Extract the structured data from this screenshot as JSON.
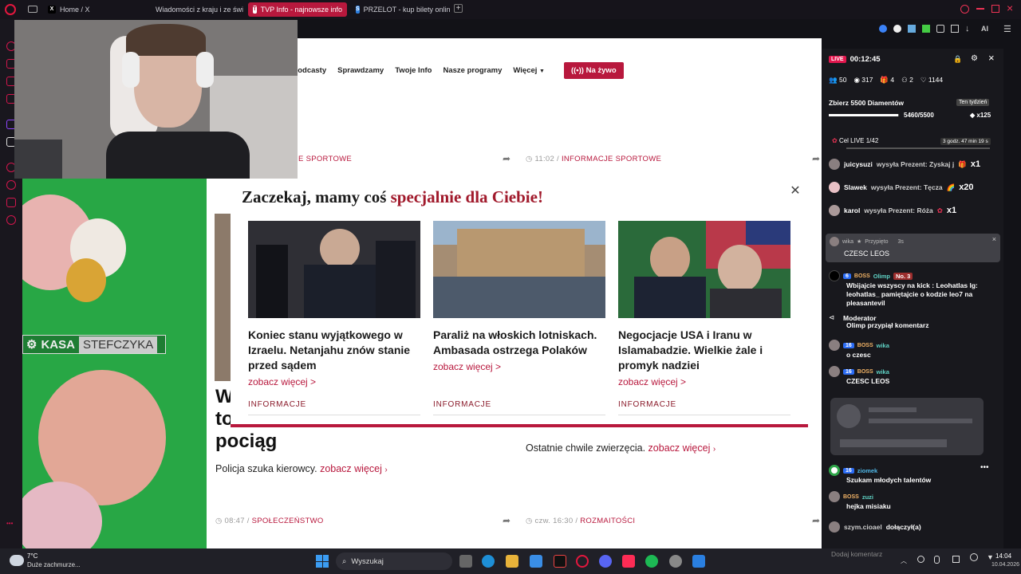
{
  "tabs": [
    {
      "label": "",
      "favicon": "app"
    },
    {
      "label": "",
      "favicon": "panel"
    },
    {
      "label": "Home / X",
      "favicon": "x"
    },
    {
      "label": "Wiadomości z kraju i ze świ",
      "favicon": "globe"
    },
    {
      "label": "TVP Info - najnowsze info",
      "favicon": "tvp",
      "active": true
    },
    {
      "label": "PRZELOT - kup bilety onlin",
      "favicon": "przelot"
    }
  ],
  "nav": {
    "items": [
      "Podcasty",
      "Sprawdzamy",
      "Twoje Info",
      "Nasze programy",
      "Więcej"
    ],
    "live_label": "Na żywo",
    "partial_left": "rt"
  },
  "articles_top": {
    "left_category": "E SPORTOWE",
    "right_time": "11:02",
    "right_category": "INFORMACJE SPORTOWE"
  },
  "ad": {
    "brand_left": "KASA",
    "brand_right": "STEFCZYKA"
  },
  "main_article": {
    "headline_lines": [
      "W",
      "to",
      "pociąg"
    ],
    "lead": "Policja szuka kierowcy.",
    "more": "zobacz więcej",
    "time": "08:47",
    "category": "SPOŁECZEŃSTWO"
  },
  "side_article": {
    "lead": "Ostatnie chwile zwierzęcia.",
    "more": "zobacz więcej",
    "time": "czw. 16:30",
    "category": "ROZMAITOŚCI"
  },
  "modal": {
    "title_plain": "Zaczekaj, mamy coś ",
    "title_accent": "specjalnie dla Ciebie!",
    "cards": [
      {
        "title": "Koniec stanu wyjątkowego w Izraelu. Netanjahu znów stanie przed sądem",
        "more": "zobacz więcej >",
        "category": "INFORMACJE"
      },
      {
        "title": "Paraliż na włoskich lotniskach. Ambasada ostrzega Polaków",
        "more": "zobacz więcej >",
        "category": "INFORMACJE"
      },
      {
        "title": "Negocjacje USA i Iranu w Islamabadzie. Wielkie żale i promyk nadziei",
        "more": "zobacz więcej >",
        "category": "INFORMACJE"
      }
    ]
  },
  "panel": {
    "live_badge": "LIVE",
    "timer": "00:12:45",
    "stats": [
      "50",
      "317",
      "4",
      "2",
      "1144"
    ],
    "goal_title": "Zbierz 5500 Diamentów",
    "goal_period": "Ten tydzień",
    "goal_progress_text": "5460/5500",
    "goal_progress": 0.993,
    "goal_multiplier": "x125",
    "live_goal": "Cel LIVE 1/42",
    "live_goal_time": "3 godz. 47 min 19 s",
    "gifts": [
      {
        "user": "juicysuzi",
        "text": "wysyła Prezent: Zyskaj j",
        "count": "x1"
      },
      {
        "user": "Slawek",
        "text": "wysyła Prezent: Tęcza",
        "count": "x20"
      },
      {
        "user": "karol",
        "text": "wysyła Prezent: Róża",
        "count": "x1"
      }
    ],
    "pinned": {
      "user": "wika",
      "tag": "Przypięto",
      "age": "3s",
      "text": "CZESC LEOS"
    },
    "messages": [
      {
        "level": "6",
        "badge": "BOSS",
        "user": "Olimp",
        "rank": "No. 3",
        "text": "Wbijajcie wszyscy na kick : Leohatlas lg: leohatlas_ pamiętajcie o kodzie leo7 na pleasantevil"
      },
      {
        "level": "",
        "badge": "",
        "user": "Moderator",
        "rank": "",
        "text": "Olimp przypiął komentarz"
      },
      {
        "level": "16",
        "badge": "BOSS",
        "user": "wika",
        "rank": "",
        "text": "o czesc"
      },
      {
        "level": "16",
        "badge": "BOSS",
        "user": "wika",
        "rank": "",
        "text": "CZESC LEOS"
      },
      {
        "level": "16",
        "badge": "",
        "user": "ziomek",
        "rank": "",
        "text": "Szukam młodych talentów"
      },
      {
        "level": "",
        "badge": "BOSS",
        "user": "zuzi",
        "rank": "",
        "text": "hejka misiaku"
      },
      {
        "level": "",
        "badge": "",
        "user": "szym.cioael",
        "rank": "",
        "text": "dołączył(a)"
      }
    ],
    "input_placeholder": "Dodaj komentarz"
  },
  "taskbar": {
    "weather_temp": "7°C",
    "weather_desc": "Duże zachmurze...",
    "search_placeholder": "Wyszukaj",
    "time": "14:04",
    "date": "10.04.2026"
  },
  "colors": {
    "accent": "#b8183d",
    "ad_green": "#28a745",
    "panel_bg": "#19191e"
  }
}
